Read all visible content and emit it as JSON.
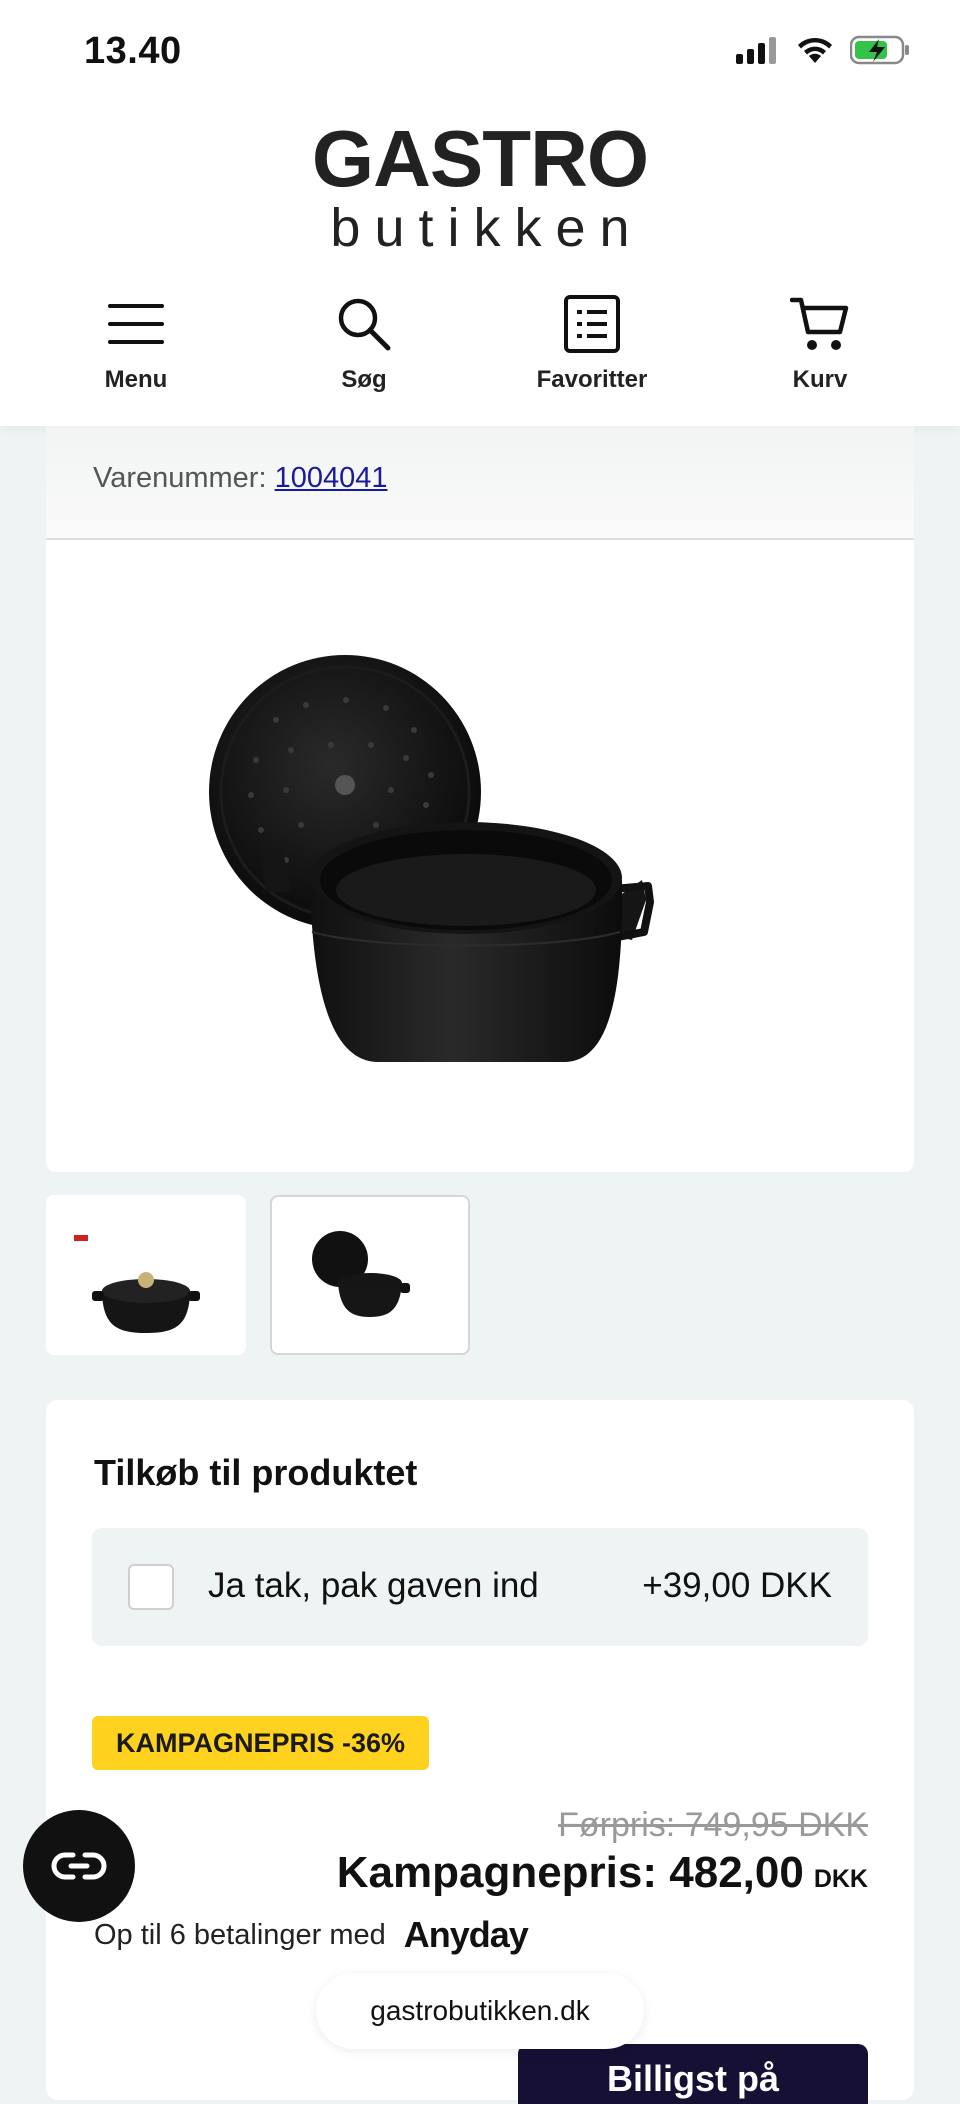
{
  "status_bar": {
    "time": "13.40"
  },
  "header": {
    "logo_main": "GASTRO",
    "logo_sub": "butikken",
    "nav": [
      {
        "label": "Menu",
        "icon": "hamburger-icon"
      },
      {
        "label": "Søg",
        "icon": "search-icon"
      },
      {
        "label": "Favoritter",
        "icon": "list-icon"
      },
      {
        "label": "Kurv",
        "icon": "cart-icon"
      }
    ]
  },
  "product": {
    "sku_label": "Varenummer:",
    "sku": "1004041",
    "thumbnails": [
      "cocotte-with-lid",
      "cocotte-open"
    ]
  },
  "addons": {
    "title": "Tilkøb til produktet",
    "items": [
      {
        "label": "Ja tak, pak gaven ind",
        "price": "+39,00 DKK",
        "checked": false
      }
    ]
  },
  "pricing": {
    "badge": "KAMPAGNEPRIS -36%",
    "old_price": "Førpris: 749,95 DKK",
    "campaign_price": "Kampagnepris: 482,00",
    "currency": "DKK",
    "installments": "Op til 6 betalinger med",
    "installments_brand": "Anyday"
  },
  "browser": {
    "url": "gastrobutikken.dk"
  },
  "cta": {
    "label": "Billigst på"
  },
  "colors": {
    "badge": "#ffd21f",
    "cta": "#161035",
    "background": "#eef3f3"
  }
}
